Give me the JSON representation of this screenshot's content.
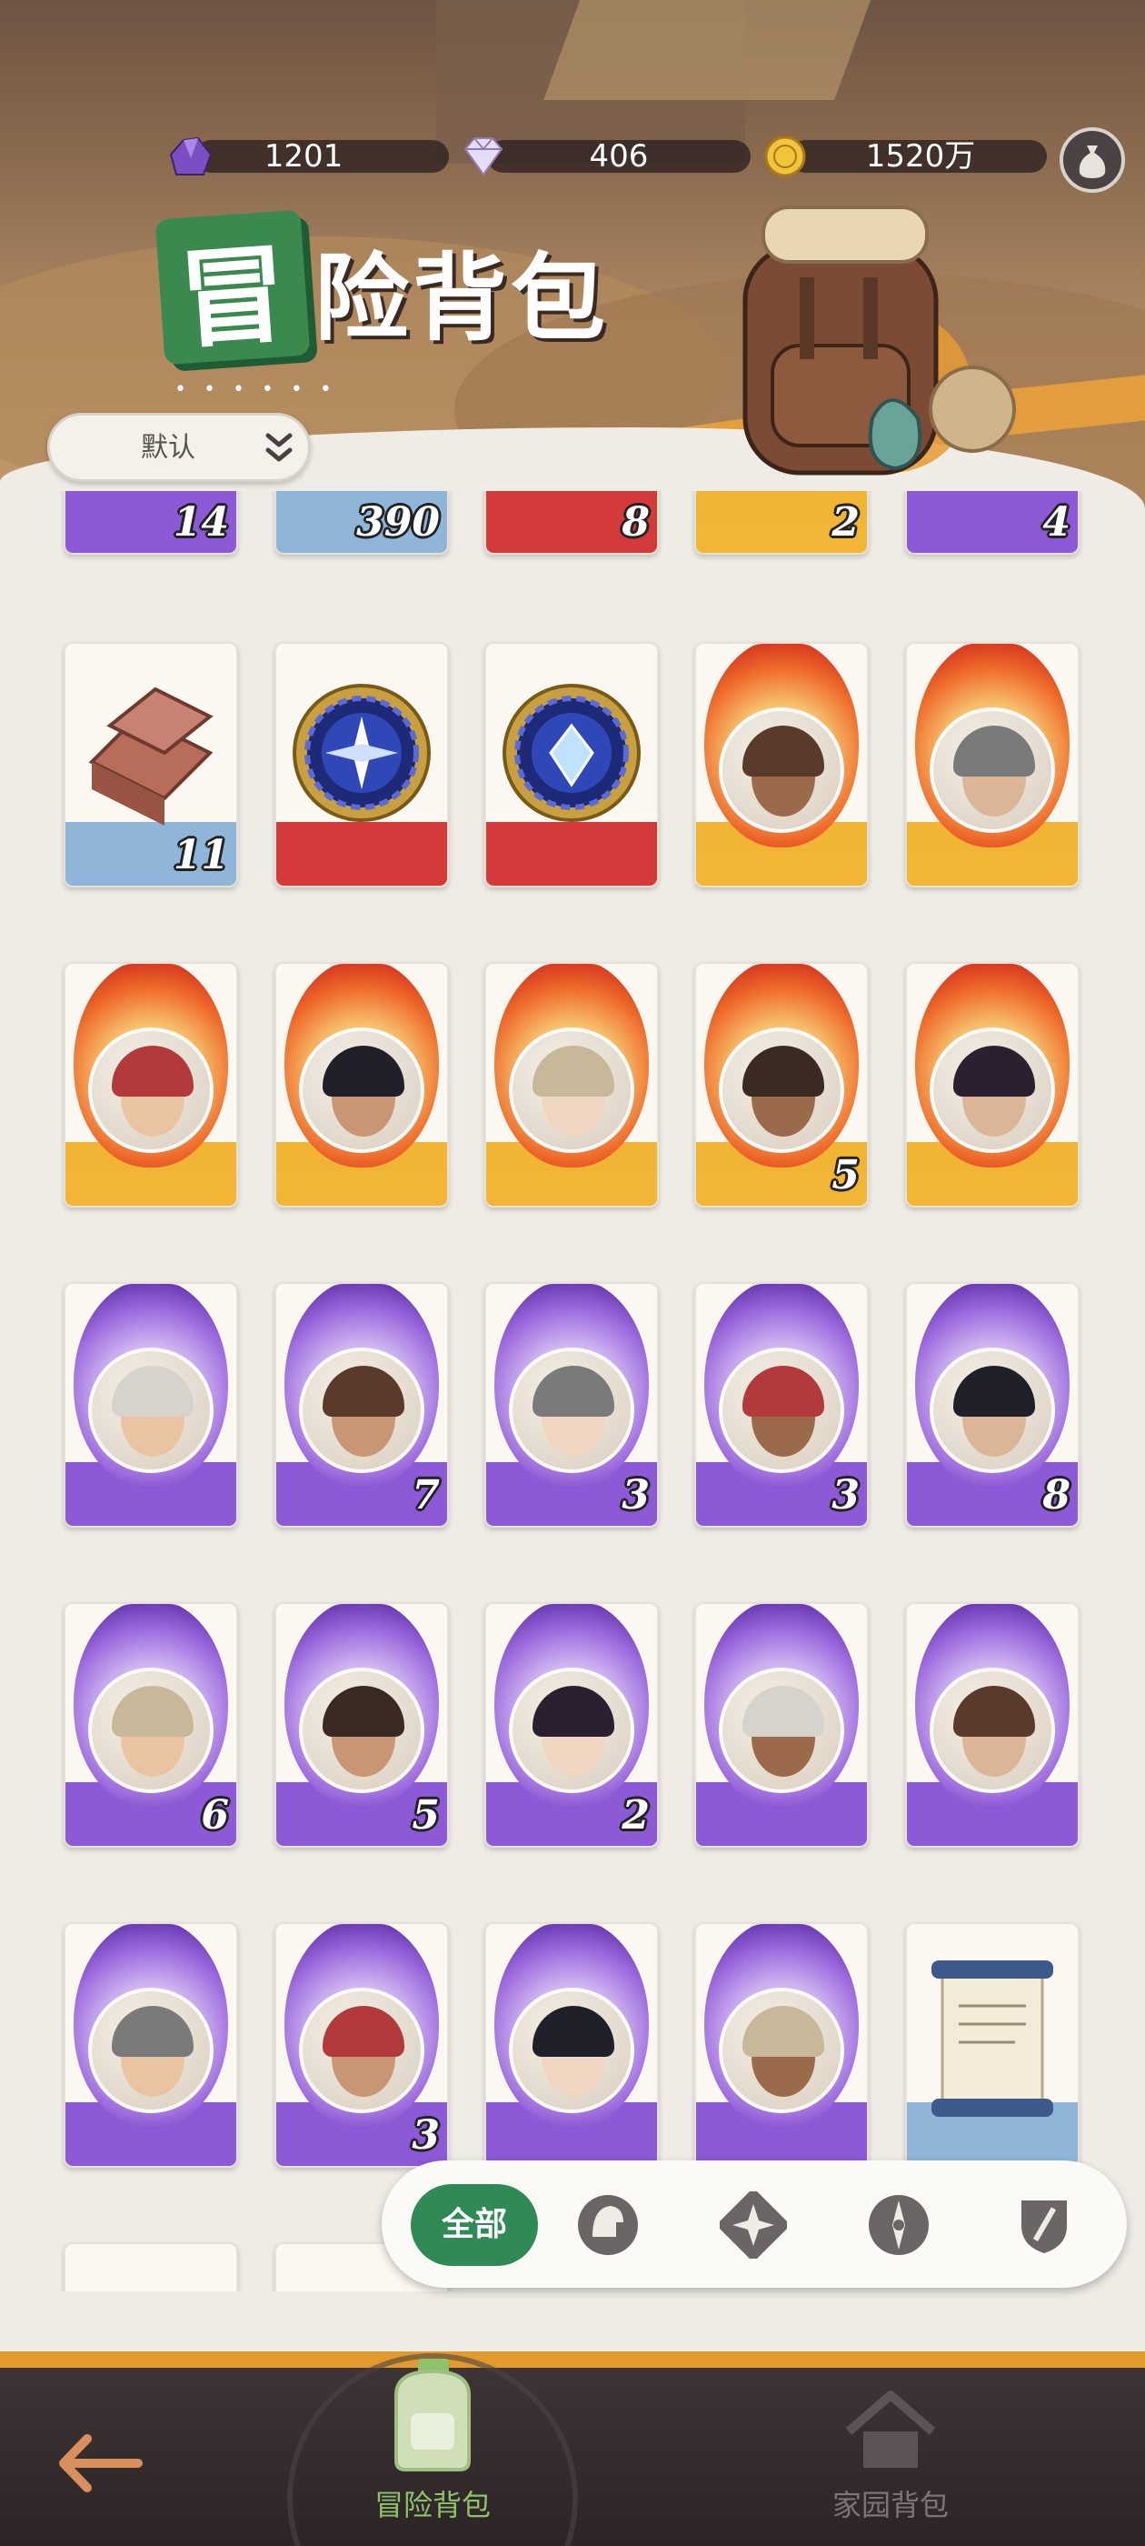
{
  "currencies": [
    {
      "icon": "purple-crystal-icon",
      "value": "1201"
    },
    {
      "icon": "diamond-icon",
      "value": "406"
    },
    {
      "icon": "gold-coin-icon",
      "value": "1520万"
    }
  ],
  "title": {
    "badge_char": "冒",
    "rest": "险背包",
    "dots": "• • • • • •"
  },
  "sort": {
    "selected": "默认"
  },
  "colors": {
    "orange_band": "#f2b534",
    "red_band": "#d53a3a",
    "purple_band": "#8c5ad6",
    "blue_band": "#8fb6d8",
    "accent_green": "#2f8a55"
  },
  "top_row_qty": [
    "14",
    "390",
    "8",
    "2",
    "4"
  ],
  "rows": [
    [
      {
        "kind": "copper-ingot",
        "qty": "11"
      },
      {
        "kind": "blue-compass-rune",
        "qty": ""
      },
      {
        "kind": "blue-gem-rune",
        "qty": ""
      },
      {
        "kind": "orange-hero",
        "qty": ""
      },
      {
        "kind": "orange-hero",
        "qty": ""
      }
    ],
    [
      {
        "kind": "orange-hero",
        "qty": ""
      },
      {
        "kind": "orange-hero",
        "qty": ""
      },
      {
        "kind": "orange-hero",
        "qty": ""
      },
      {
        "kind": "orange-hero",
        "qty": "5"
      },
      {
        "kind": "orange-hero",
        "qty": ""
      }
    ],
    [
      {
        "kind": "purple-hero",
        "qty": ""
      },
      {
        "kind": "purple-hero",
        "qty": "7"
      },
      {
        "kind": "purple-hero",
        "qty": "3"
      },
      {
        "kind": "purple-hero",
        "qty": "3"
      },
      {
        "kind": "purple-hero",
        "qty": "8"
      }
    ],
    [
      {
        "kind": "purple-hero",
        "qty": "6"
      },
      {
        "kind": "purple-hero",
        "qty": "5"
      },
      {
        "kind": "purple-hero",
        "qty": "2"
      },
      {
        "kind": "purple-hero",
        "qty": ""
      },
      {
        "kind": "purple-hero",
        "qty": ""
      }
    ],
    [
      {
        "kind": "purple-hero",
        "qty": ""
      },
      {
        "kind": "purple-hero",
        "qty": "3"
      },
      {
        "kind": "purple-hero",
        "qty": ""
      },
      {
        "kind": "purple-hero",
        "qty": ""
      },
      {
        "kind": "scroll",
        "qty": ""
      }
    ]
  ],
  "filter": {
    "all_label": "全部",
    "icons": [
      "helmet-icon",
      "star-badge-icon",
      "compass-icon",
      "sword-shield-icon"
    ]
  },
  "nav": {
    "back_icon": "back-arrow-icon",
    "tabs": [
      {
        "label": "冒险背包",
        "icon": "backpack-icon",
        "active": true
      },
      {
        "label": "家园背包",
        "icon": "house-icon",
        "active": false
      }
    ]
  }
}
